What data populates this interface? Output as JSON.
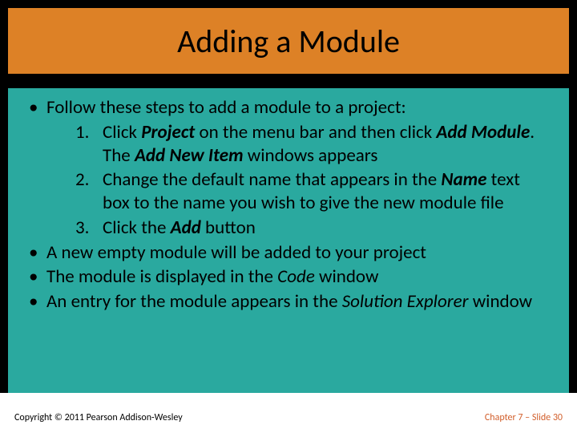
{
  "title": "Adding a Module",
  "bullets": {
    "intro": "Follow these steps to add a module to a project:",
    "steps": [
      {
        "pre": "Click ",
        "b1": "Project",
        "mid1": " on the menu bar and then click ",
        "b2": "Add Module",
        "mid2": ". The ",
        "b3": "Add New Item",
        "post": " windows appears"
      },
      {
        "pre": "Change the default name that appears in the ",
        "b1": "Name",
        "post": " text box to the name you wish to give the new module file"
      },
      {
        "pre": "Click the ",
        "b1": "Add",
        "post": " button"
      }
    ],
    "after": [
      "A new empty module will be added to your project",
      {
        "pre": "The module is displayed in the ",
        "i1": "Code",
        "post": " window"
      },
      {
        "pre": "An entry for the module appears in the ",
        "i1": "Solution Explorer",
        "post": " window"
      }
    ]
  },
  "footer": {
    "copyright": "Copyright © 2011 Pearson Addison-Wesley",
    "pageref": "Chapter 7 – Slide 30"
  }
}
